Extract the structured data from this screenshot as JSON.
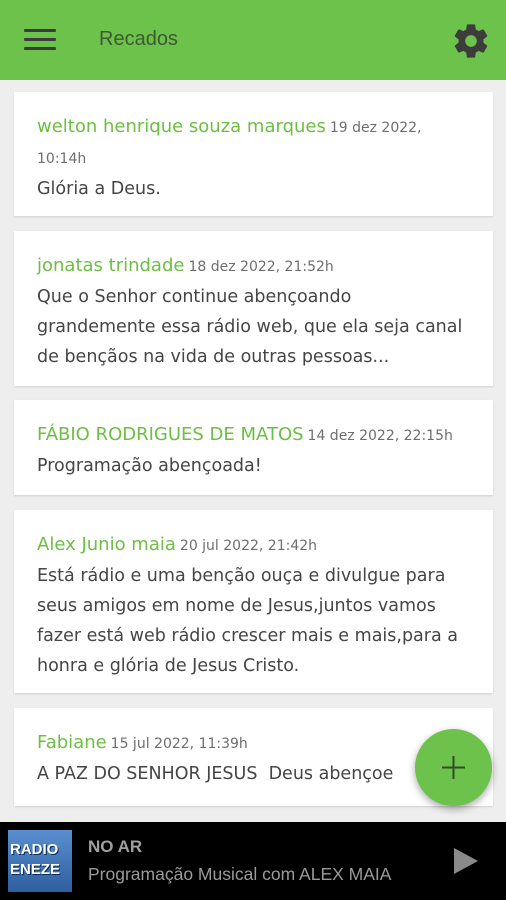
{
  "app": {
    "title": "Recados",
    "accent_color": "#6cc24a",
    "icons": {
      "menu": "hamburger-menu-icon",
      "settings": "gear-icon",
      "add": "plus-icon",
      "play": "play-icon"
    }
  },
  "messages": [
    {
      "author": "welton henrique souza marques",
      "date": "19 dez 2022, 10:14h",
      "text": "Glória a Deus."
    },
    {
      "author": "jonatas trindade",
      "date": "18 dez 2022, 21:52h",
      "text": "Que o Senhor continue abençoando grandemente essa rádio web, que ela seja canal de bençãos na vida de outras pessoas..."
    },
    {
      "author": "FÁBIO RODRIGUES DE MATOS",
      "date": "14 dez 2022, 22:15h",
      "text": "Programação abençoada!"
    },
    {
      "author": "Alex Junio maia",
      "date": "20 jul 2022, 21:42h",
      "text": "Está rádio e uma benção ouça e divulgue para seus amigos em nome de Jesus,juntos vamos fazer está web rádio crescer mais e mais,para a honra e glória de Jesus Cristo."
    },
    {
      "author": "Fabiane",
      "date": "15 jul 2022, 11:39h",
      "text": "A PAZ DO SENHOR JESUS  Deus abençoe"
    }
  ],
  "player": {
    "logo_line1": "RADIO",
    "logo_line2": "ENEZE",
    "status": "NO AR",
    "program": "Programação Musical com ALEX MAIA"
  }
}
